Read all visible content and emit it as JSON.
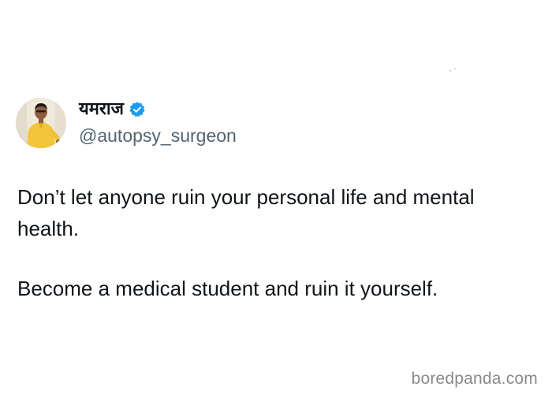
{
  "tweet": {
    "author": {
      "display_name": "यमराज",
      "handle": "@autopsy_surgeon",
      "verified": true,
      "verified_icon": "verified-badge-icon",
      "avatar_icon": "person-avatar"
    },
    "paragraphs": [
      "Don’t let anyone ruin your personal life and mental health.",
      "Become a medical student and ruin it yourself."
    ]
  },
  "watermark": "boredpanda.com",
  "colors": {
    "text_primary": "#0f1419",
    "text_secondary": "#536471",
    "verified_blue": "#1d9bf0",
    "watermark_gray": "#8a8a8a"
  }
}
